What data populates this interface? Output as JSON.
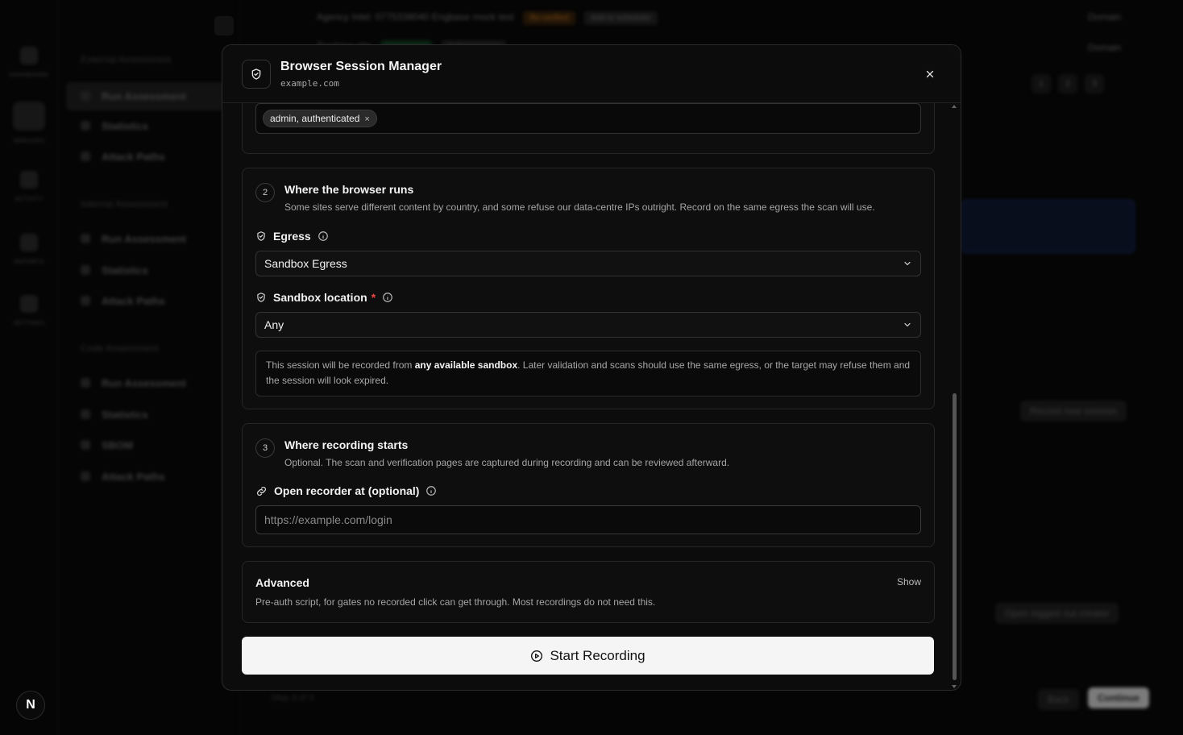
{
  "modal": {
    "title": "Browser Session Manager",
    "subtitle": "example.com",
    "roles_tag": "admin, authenticated",
    "tag_remove": "×",
    "steps": [
      {
        "num": "2",
        "title": "Where the browser runs",
        "desc": "Some sites serve different content by country, and some refuse our data-centre IPs outright. Record on the same egress the scan will use."
      },
      {
        "num": "3",
        "title": "Where recording starts",
        "desc": "Optional. The scan and verification pages are captured during recording and can be reviewed afterward."
      }
    ],
    "egress": {
      "label": "Egress",
      "value": "Sandbox Egress"
    },
    "sandbox_location": {
      "label": "Sandbox location",
      "required_mark": "*",
      "value": "Any"
    },
    "note": {
      "prefix": "This session will be recorded from ",
      "bold": "any available sandbox",
      "suffix": ". Later validation and scans should use the same egress, or the target may refuse them and the session will look expired."
    },
    "recorder": {
      "label": "Open recorder at (optional)",
      "placeholder": "https://example.com/login"
    },
    "advanced": {
      "title": "Advanced",
      "toggle": "Show",
      "desc": "Pre-auth script, for gates no recorded click can get through. Most recordings do not need this."
    },
    "start_button": "Start Recording"
  },
  "background": {
    "rail_items": [
      "Dashboard",
      "Services",
      "Activity",
      "Reports",
      "Settings"
    ],
    "sections": [
      "External Assessment",
      "Internal Assessment",
      "Code Assessment"
    ],
    "ext_items": [
      "Run Assessment",
      "Statistics",
      "Attack Paths"
    ],
    "int_items": [
      "Run Assessment",
      "Statistics",
      "Attack Paths"
    ],
    "code_items": [
      "Run Assessment",
      "Statistics",
      "SBOM",
      "Attack Paths"
    ],
    "rows": [
      "Agency Intel: 0775338040 Engbase mock test",
      "Tracking site"
    ],
    "row_badges": [
      "Re-verified",
      "Add to scheduler",
      "Connected",
      "Active session"
    ],
    "row_status": [
      "Domain",
      "Domain"
    ],
    "pages": [
      "1",
      "2",
      "3"
    ],
    "record_new": "Record new session",
    "open_logged": "Open logged out creator",
    "step_text": "Step 3 of 3",
    "back": "Back",
    "continue": "Continue",
    "avatar": "N"
  }
}
